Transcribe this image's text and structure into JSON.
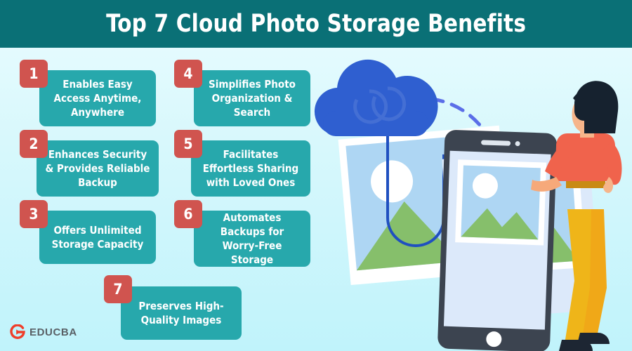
{
  "header": {
    "title": "Top 7 Cloud Photo Storage Benefits",
    "bg_color": "#0a7076",
    "text_color": "#ffffff"
  },
  "theme": {
    "background_top": "#eafcff",
    "background_bottom": "#c0f3fb",
    "card_color": "#27a8ac",
    "badge_color": "#d0544f",
    "cloud_color": "#2f5fd0",
    "accent_dashed": "#5b6ee8"
  },
  "benefits": [
    {
      "number": "1",
      "text": "Enables Easy Access Anytime, Anywhere"
    },
    {
      "number": "2",
      "text": "Enhances Security & Provides Reliable Backup"
    },
    {
      "number": "3",
      "text": "Offers Unlimited Storage Capacity"
    },
    {
      "number": "4",
      "text": "Simplifies Photo Organization & Search"
    },
    {
      "number": "5",
      "text": "Facilitates Effortless Sharing with Loved Ones"
    },
    {
      "number": "6",
      "text": "Automates Backups for Worry-Free Storage"
    },
    {
      "number": "7",
      "text": "Preserves High-Quality Images"
    }
  ],
  "logo": {
    "text": "EDUCBA",
    "mark_color": "#ef3e2a",
    "text_color": "#5a6066"
  },
  "illustration": {
    "cloud": "cloud-icon",
    "phone": "smartphone",
    "photos": "photo-card",
    "person": "woman-standing",
    "arc": "dashed-arc"
  }
}
